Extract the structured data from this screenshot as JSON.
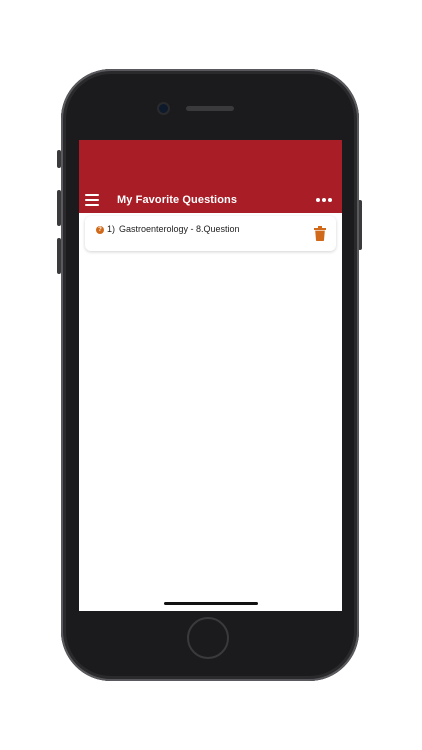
{
  "header": {
    "title": "My Favorite Questions",
    "menu_icon": "hamburger-menu-icon",
    "more_icon": "more-horizontal-icon"
  },
  "favorites": {
    "items": [
      {
        "index": "1)",
        "label": "Gastroenterology - 8.Question",
        "icon": "question-circle-icon",
        "action_icon": "trash-icon"
      }
    ]
  },
  "colors": {
    "app_bar": "#a81d26",
    "accent": "#d06a1a"
  }
}
